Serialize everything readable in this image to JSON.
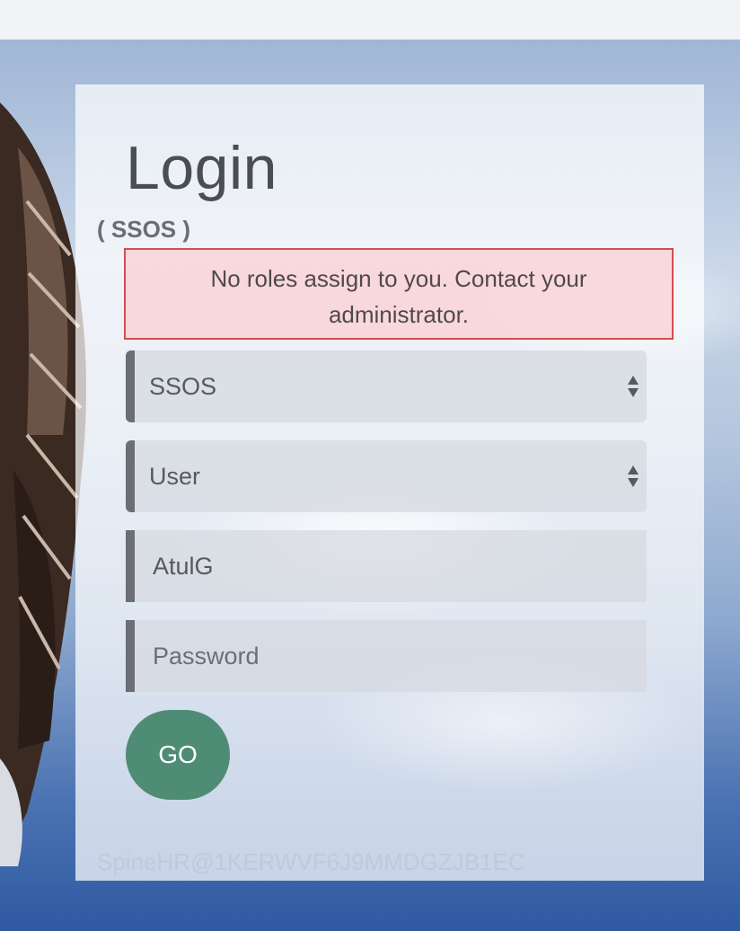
{
  "login": {
    "title": "Login",
    "subtitle": "( SSOS )",
    "alert_message": "No roles assign to you. Contact your administrator.",
    "application_select": {
      "value": "SSOS"
    },
    "role_select": {
      "value": "User"
    },
    "username_input": {
      "value": "AtulG"
    },
    "password_input": {
      "placeholder": "Password"
    },
    "go_label": "GO",
    "footer_text": "SpineHR@1KERWVF6J9MMDGZJB1EC"
  },
  "colors": {
    "alert_border": "#d24e50",
    "alert_background": "#fad6da",
    "go_button": "#4f8c75"
  }
}
